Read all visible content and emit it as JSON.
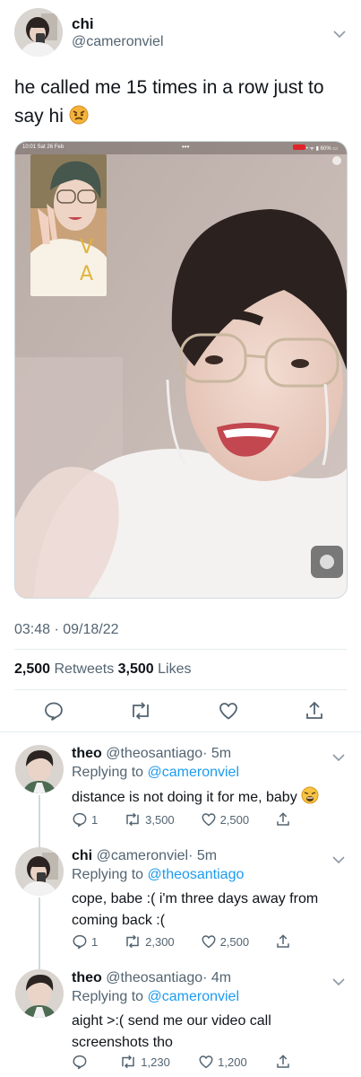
{
  "tweet": {
    "name": "chi",
    "handle": "@cameronviel",
    "text": "he called me 15 times in a row just to say hi",
    "emoji": "angry-face",
    "timestamp": "03:48 · 09/18/22",
    "retweets_count": "2,500",
    "retweets_label": "Retweets",
    "likes_count": "3,500",
    "likes_label": "Likes"
  },
  "media": {
    "status_time": "10:01  Sat 26 Feb",
    "status_dots": "•••",
    "status_battery": "• ᯤ ▮ 60% ▭"
  },
  "replies": [
    {
      "name": "theo",
      "handle": "@theosantiago",
      "time": "· 5m",
      "replying_prefix": "Replying to",
      "replying_to": "@cameronviel",
      "text": "distance is not doing it for me, baby",
      "emoji": "weary-face",
      "reply_count": "1",
      "retweet_count": "3,500",
      "like_count": "2,500"
    },
    {
      "name": "chi",
      "handle": "@cameronviel",
      "time": "· 5m",
      "replying_prefix": "Replying to",
      "replying_to": "@theosantiago",
      "text": "cope, babe :(  i'm three days away from coming back :(",
      "reply_count": "1",
      "retweet_count": "2,300",
      "like_count": "2,500"
    },
    {
      "name": "theo",
      "handle": "@theosantiago",
      "time": "· 4m",
      "replying_prefix": "Replying to",
      "replying_to": "@cameronviel",
      "text": "aight >:( send me our video call screenshots tho",
      "reply_count": "",
      "retweet_count": "1,230",
      "like_count": "1,200"
    }
  ],
  "colors": {
    "accent": "#1d9bf0",
    "muted": "#536471",
    "divider": "#e6ecf0"
  }
}
